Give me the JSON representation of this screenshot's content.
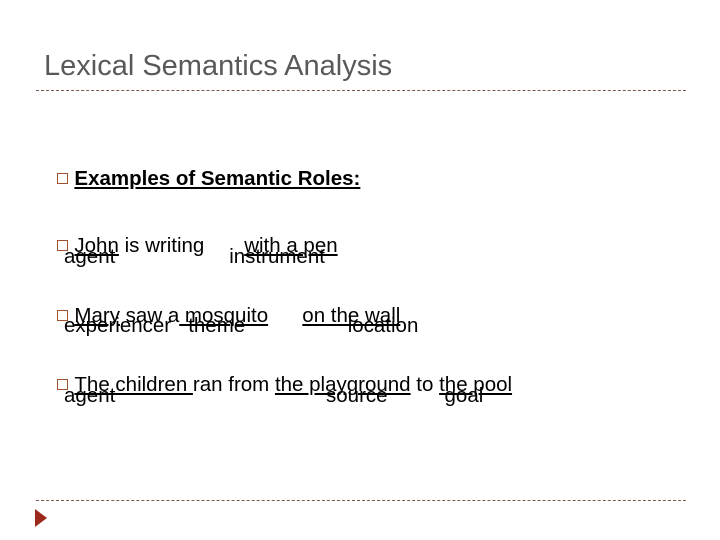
{
  "title": "Lexical Semantics Analysis",
  "heading": "Examples of Semantic Roles:",
  "examples": [
    {
      "sentence": [
        {
          "text": "John",
          "underline": true
        },
        {
          "text": " is writing       ",
          "underline": false
        },
        {
          "text": "with a pen",
          "underline": true
        }
      ],
      "roles": "agent                    instrument"
    },
    {
      "sentence": [
        {
          "text": "Mary",
          "underline": true
        },
        {
          "text": " saw a",
          "underline": false
        },
        {
          "text": " mosquito",
          "underline": true
        },
        {
          "text": "      ",
          "underline": false
        },
        {
          "text": "on the wall",
          "underline": true
        }
      ],
      "roles": "experiencer   theme                  location"
    },
    {
      "sentence": [
        {
          "text": "The children ",
          "underline": true
        },
        {
          "text": "ran from ",
          "underline": false
        },
        {
          "text": "the playground",
          "underline": true
        },
        {
          "text": " to ",
          "underline": false
        },
        {
          "text": "the pool",
          "underline": true
        }
      ],
      "roles": "agent                                     source          goal"
    }
  ],
  "colors": {
    "title": "#595959",
    "bullet": "#a0522d",
    "rule": "#7a5a4a",
    "arrow": "#9b2a1c"
  }
}
